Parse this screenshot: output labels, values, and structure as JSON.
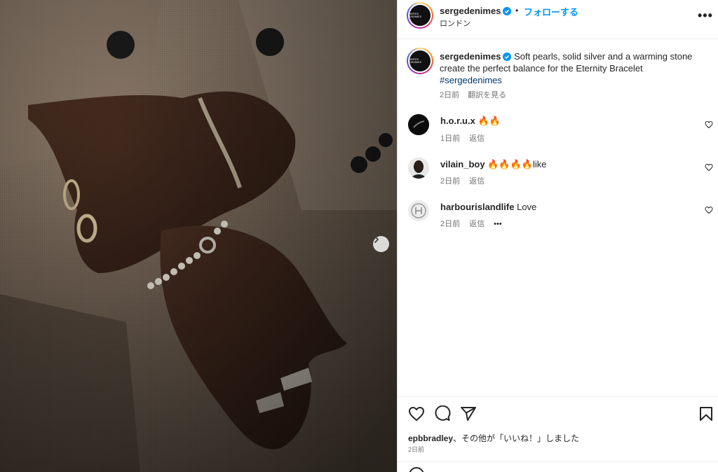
{
  "post": {
    "author": "sergedenimes",
    "logo_text": "SERGE DENIMES",
    "follow_label": "フォローする",
    "separator": "•",
    "location": "ロンドン",
    "more_label": "•••",
    "caption_text": "Soft pearls, solid silver and a warming stone create the perfect balance for the Eternity Bracelet",
    "hashtag": "#sergedenimes",
    "caption_age": "2日前",
    "translate_label": "翻訳を見る"
  },
  "comments": [
    {
      "user": "h.o.r.u.x",
      "text": "🔥🔥",
      "age": "1日前",
      "reply_label": "返信"
    },
    {
      "user": "vilain_boy",
      "text": "🔥🔥🔥🔥like",
      "age": "2日前",
      "reply_label": "返信"
    },
    {
      "user": "harbourislandlife",
      "text": "Love",
      "age": "2日前",
      "reply_label": "返信",
      "more_label": "•••"
    }
  ],
  "footer": {
    "liked_by_user": "epbbradley",
    "liked_by_rest": "、その他が「いいね！」しました",
    "age": "2日前"
  },
  "icons": {
    "verified": "verified-badge-icon",
    "like": "heart-icon",
    "comment": "comment-icon",
    "share": "paper-plane-icon",
    "save": "bookmark-icon",
    "next": "chevron-right-icon"
  },
  "colors": {
    "accent": "#0095f6",
    "hashtag": "#00376b",
    "muted": "#737373",
    "verified": "#0095f6"
  }
}
